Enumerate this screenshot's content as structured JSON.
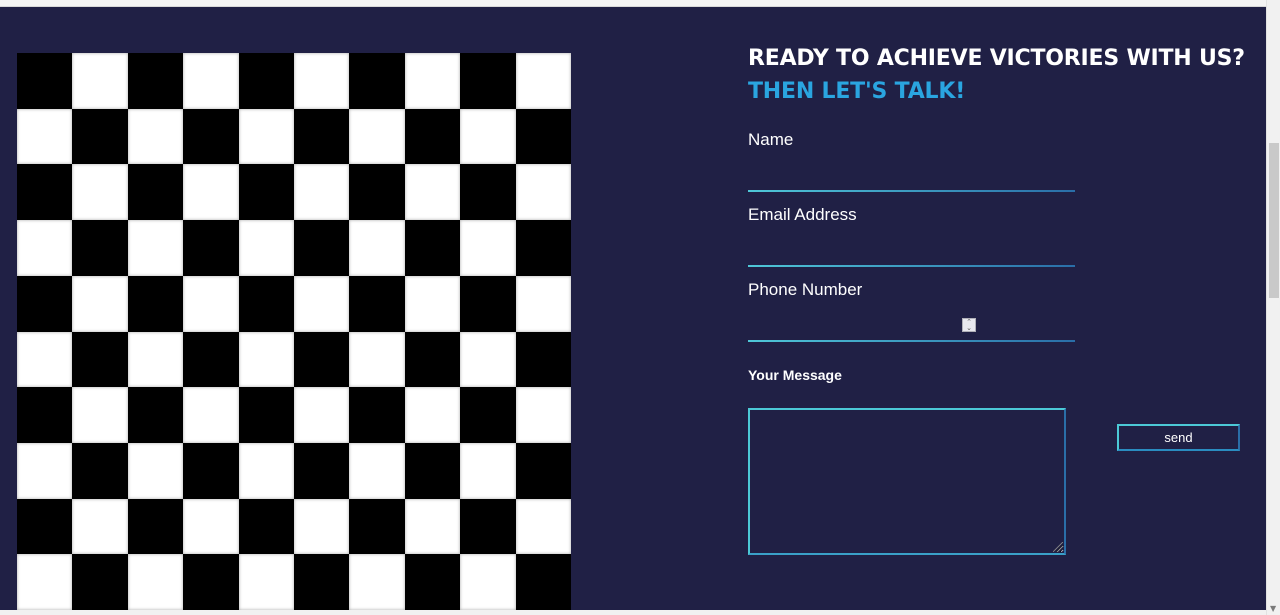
{
  "contact": {
    "heading": "READY TO ACHIEVE VICTORIES WITH US?",
    "subheading": "THEN LET'S TALK!",
    "accent_color": "#2aa5e0",
    "background_color": "#202045",
    "fields": {
      "name": {
        "label": "Name",
        "value": ""
      },
      "email": {
        "label": "Email Address",
        "value": ""
      },
      "phone": {
        "label": "Phone Number",
        "value": ""
      }
    },
    "message": {
      "label": "Your Message",
      "value": ""
    },
    "send_label": "send"
  },
  "board": {
    "rows": 10,
    "cols": 10,
    "colors": {
      "light": "#ffffff",
      "dark": "#000000"
    }
  },
  "icons": {
    "spinner": "number-spinner-icon",
    "scroll_down": "scroll-down-arrow-icon",
    "resize": "resize-grip-icon"
  }
}
